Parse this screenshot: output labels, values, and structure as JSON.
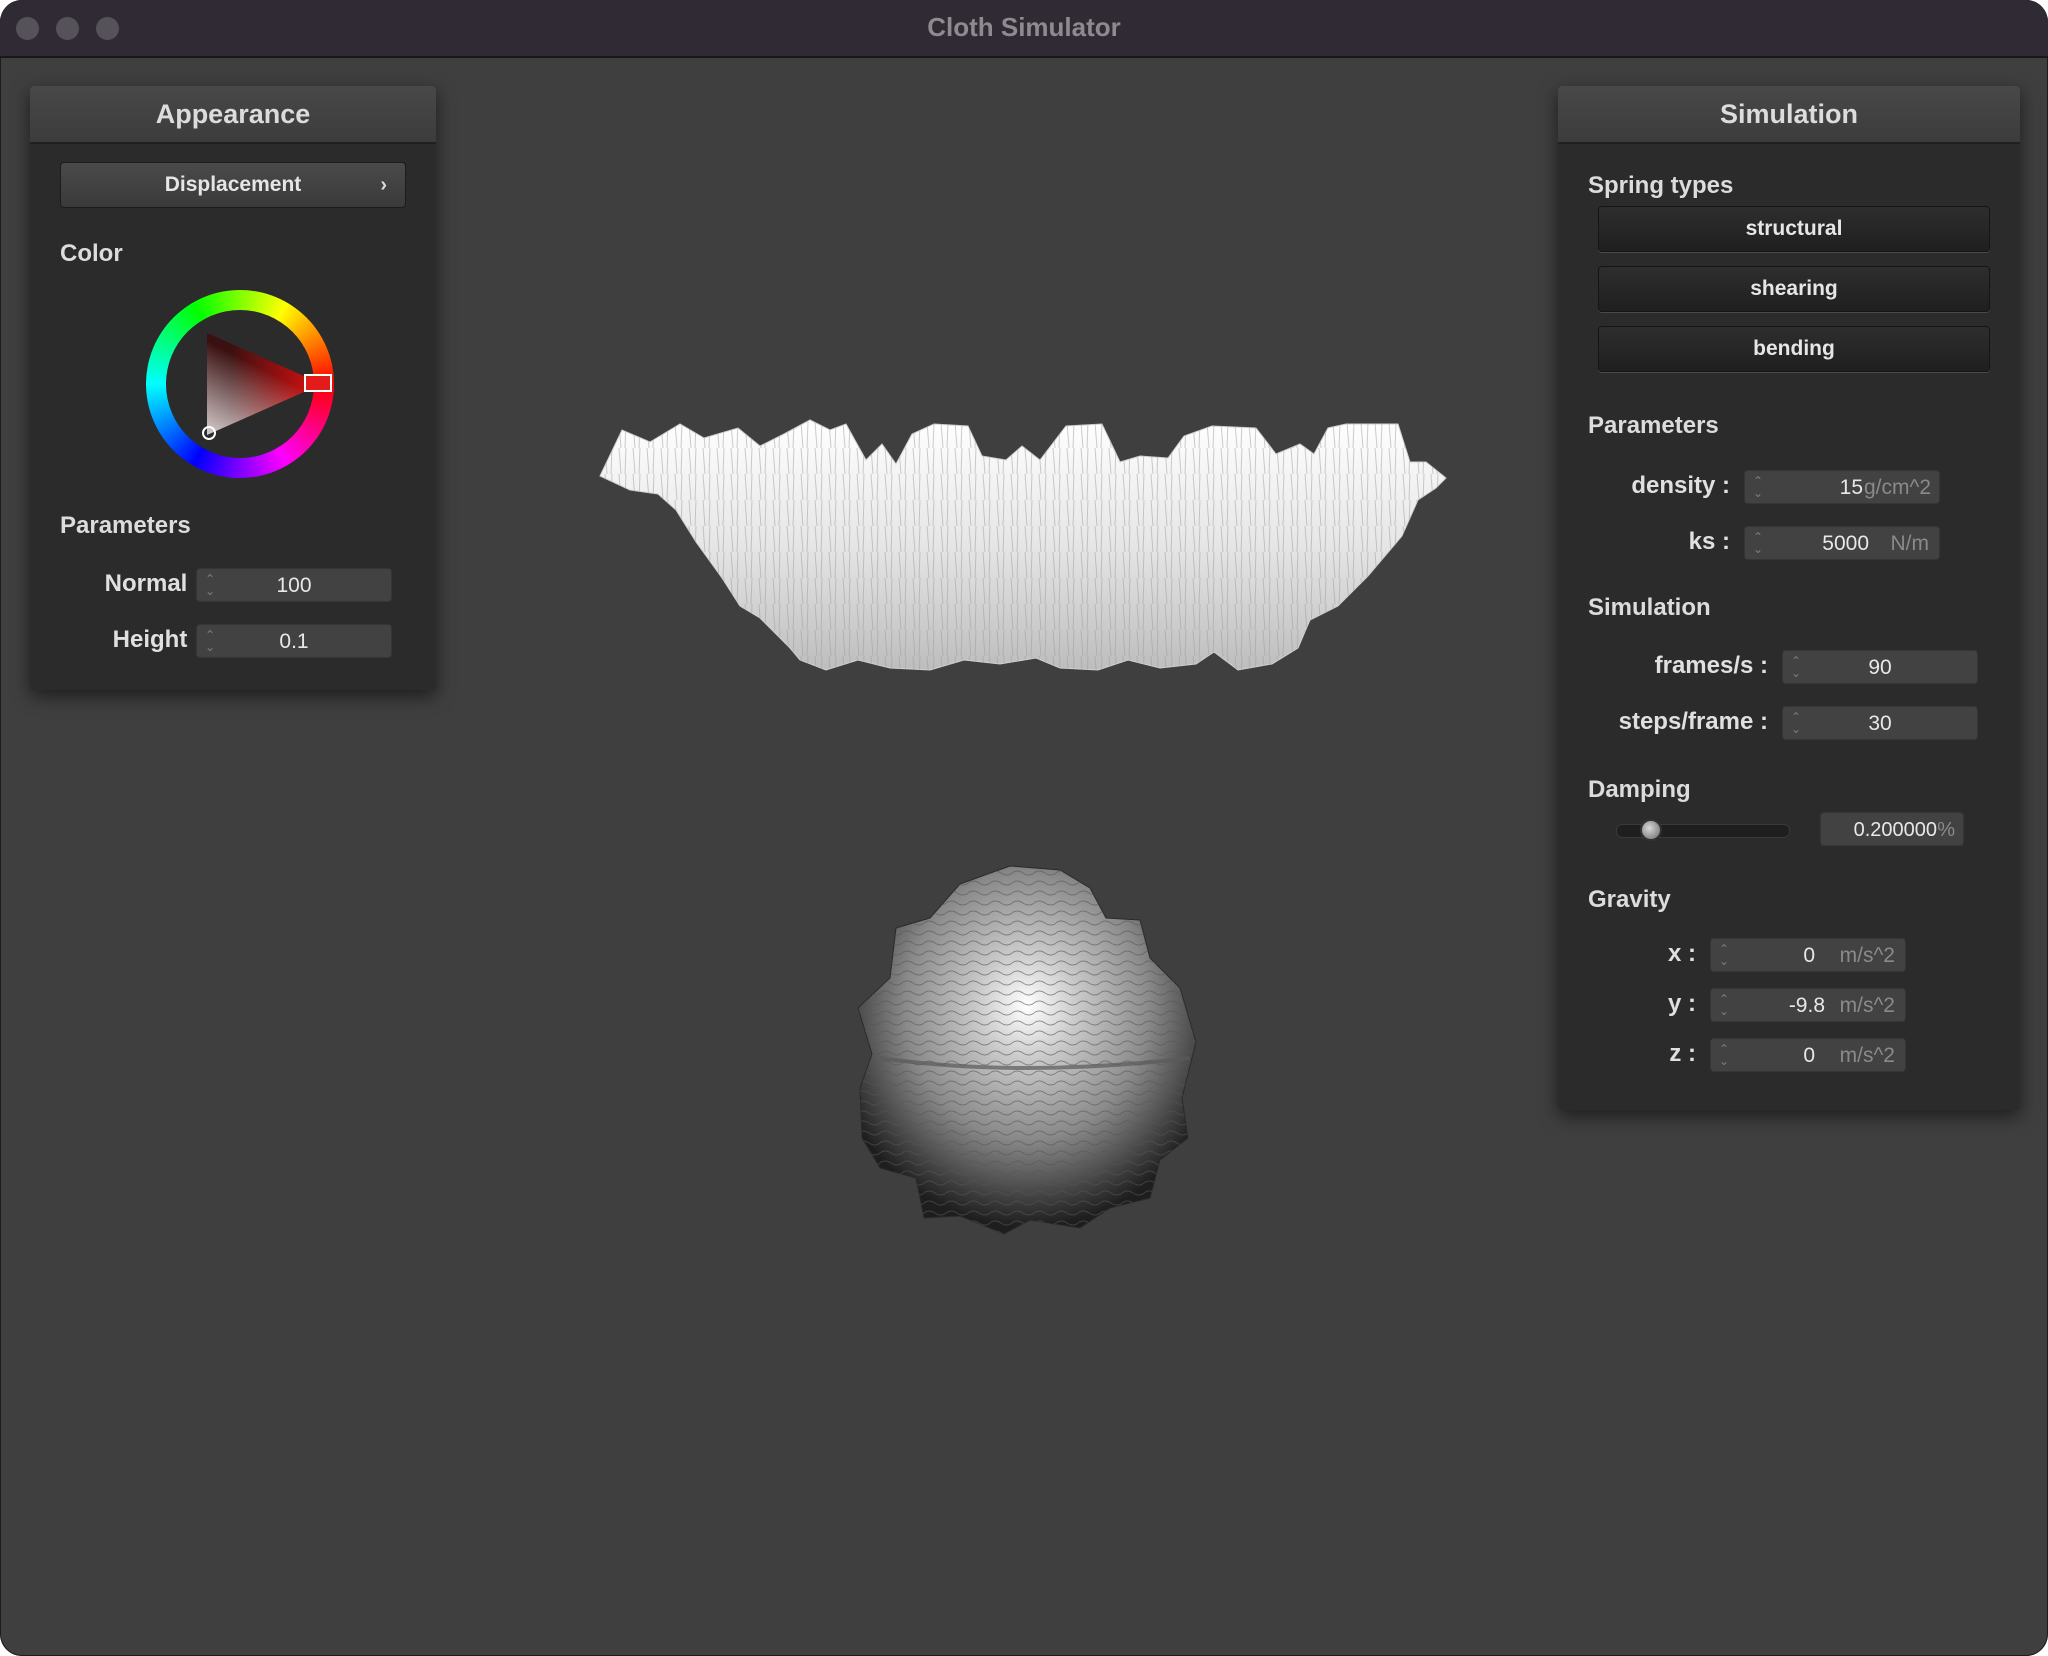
{
  "window": {
    "title": "Cloth Simulator"
  },
  "appearance": {
    "header": "Appearance",
    "shader_dropdown": "Displacement",
    "color_label": "Color",
    "color_wheel_selected": "#e31b1b",
    "parameters_label": "Parameters",
    "normal": {
      "label": "Normal :",
      "value": "100"
    },
    "height": {
      "label": "Height :",
      "value": "0.1"
    }
  },
  "simulation": {
    "header": "Simulation",
    "spring_types_label": "Spring types",
    "spring_buttons": [
      "structural",
      "shearing",
      "bending"
    ],
    "parameters_label": "Parameters",
    "density": {
      "label": "density :",
      "value": "15",
      "unit": "g/cm^2"
    },
    "ks": {
      "label": "ks :",
      "value": "5000",
      "unit": "N/m"
    },
    "simulation_label": "Simulation",
    "fps": {
      "label": "frames/s :",
      "value": "90"
    },
    "steps": {
      "label": "steps/frame :",
      "value": "30"
    },
    "damping_label": "Damping",
    "damping": {
      "value": "0.200000",
      "unit": "%",
      "slider_fraction": 0.1
    },
    "gravity_label": "Gravity",
    "gravity": [
      {
        "label": "x :",
        "value": "0",
        "unit": "m/s^2"
      },
      {
        "label": "y :",
        "value": "-9.8",
        "unit": "m/s^2"
      },
      {
        "label": "z :",
        "value": "0",
        "unit": "m/s^2"
      }
    ]
  }
}
